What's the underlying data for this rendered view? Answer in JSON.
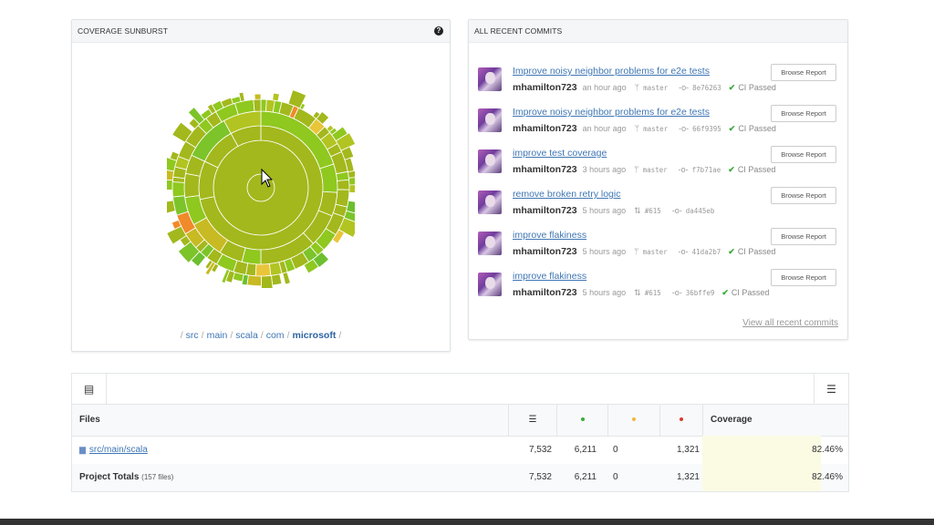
{
  "sunburst_panel": {
    "title": "COVERAGE SUNBURST",
    "help_icon": "question-circle-icon",
    "breadcrumbs": [
      "src",
      "main",
      "scala",
      "com",
      "microsoft"
    ]
  },
  "commits_panel": {
    "title": "ALL RECENT COMMITS",
    "view_all_label": "View all recent commits",
    "commits": [
      {
        "title": "Improve noisy neighbor problems for e2e tests",
        "user": "mhamilton723",
        "time": "an hour ago",
        "ref_icon": "branch-icon",
        "ref": "master",
        "sha": "8e76263",
        "ci": "CI Passed",
        "browse": "Browse Report"
      },
      {
        "title": "Improve noisy neighbor problems for e2e tests",
        "user": "mhamilton723",
        "time": "an hour ago",
        "ref_icon": "branch-icon",
        "ref": "master",
        "sha": "66f9395",
        "ci": "CI Passed",
        "browse": "Browse Report"
      },
      {
        "title": "improve test coverage",
        "user": "mhamilton723",
        "time": "3 hours ago",
        "ref_icon": "branch-icon",
        "ref": "master",
        "sha": "f7b71ae",
        "ci": "CI Passed",
        "browse": "Browse Report"
      },
      {
        "title": "remove broken retry logic",
        "user": "mhamilton723",
        "time": "5 hours ago",
        "ref_icon": "pull-request-icon",
        "ref": "#615",
        "sha": "da445eb",
        "ci": "",
        "browse": "Browse Report"
      },
      {
        "title": "improve flakiness",
        "user": "mhamilton723",
        "time": "5 hours ago",
        "ref_icon": "branch-icon",
        "ref": "master",
        "sha": "41da2b7",
        "ci": "CI Passed",
        "browse": "Browse Report"
      },
      {
        "title": "improve flakiness",
        "user": "mhamilton723",
        "time": "5 hours ago",
        "ref_icon": "pull-request-icon",
        "ref": "#615",
        "sha": "36bffe9",
        "ci": "CI Passed",
        "browse": "Browse Report"
      }
    ]
  },
  "table": {
    "headers": {
      "files": "Files",
      "coverage": "Coverage"
    },
    "header_icons": {
      "lines": "lines-icon",
      "hit": "green-dot-icon",
      "partial": "yellow-dot-icon",
      "miss": "red-dot-icon"
    },
    "colors": {
      "hit": "#3bab3b",
      "partial": "#f5b441",
      "miss": "#e0382e"
    },
    "rows": [
      {
        "name": "src/main/scala",
        "lines": "7,532",
        "hit": "6,211",
        "partial": "0",
        "miss": "1,321",
        "coverage": "82.46%"
      }
    ],
    "totals": {
      "label": "Project Totals",
      "files_note": "(157 files)",
      "lines": "7,532",
      "hit": "6,211",
      "partial": "0",
      "miss": "1,321",
      "coverage": "82.46%"
    }
  }
}
